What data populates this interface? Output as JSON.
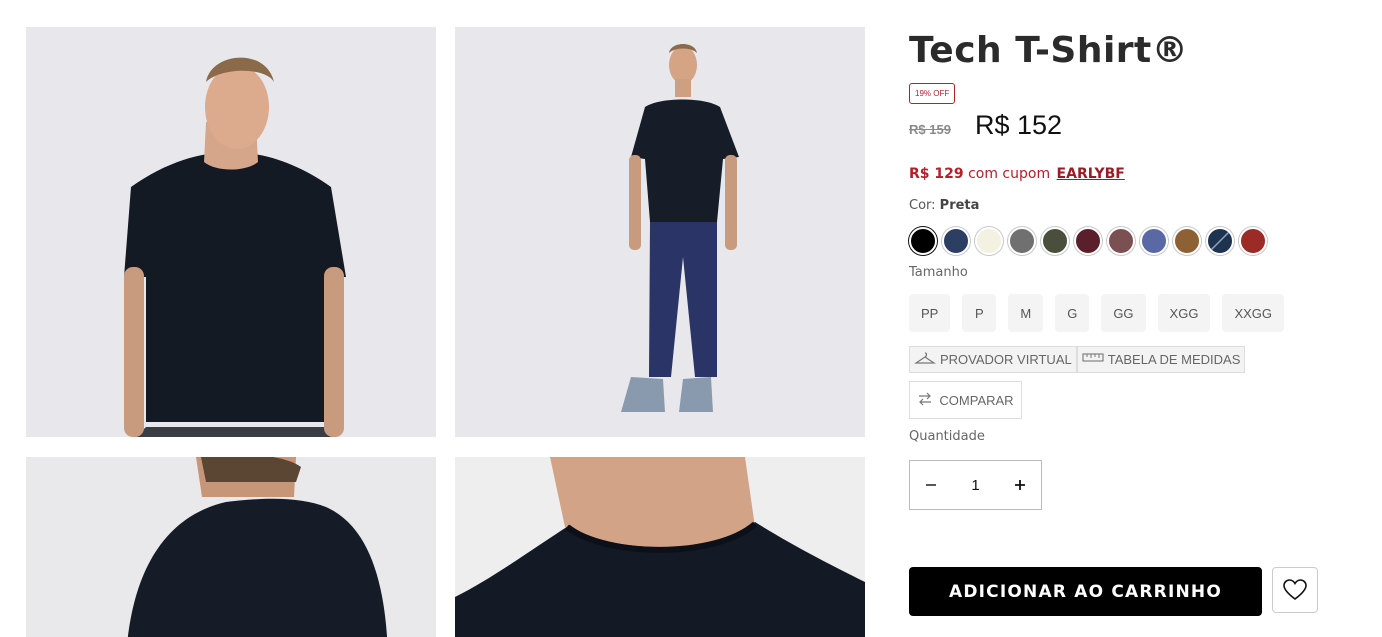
{
  "product": {
    "title": "Tech T-Shirt®",
    "discount_badge": "19% OFF",
    "old_price": "R$ 159",
    "price": "R$ 152",
    "coupon": {
      "value": "R$ 129",
      "text": "com cupom",
      "code": "EARLYBF"
    }
  },
  "color": {
    "label": "Cor:",
    "selected": "Preta",
    "swatches": [
      {
        "name": "black",
        "hex": "#000000"
      },
      {
        "name": "navy",
        "hex": "#2c3e62"
      },
      {
        "name": "off-white",
        "hex": "#f3f1e2"
      },
      {
        "name": "gray",
        "hex": "#707070"
      },
      {
        "name": "olive",
        "hex": "#4a4e3c"
      },
      {
        "name": "wine",
        "hex": "#5b1e2b"
      },
      {
        "name": "mauve",
        "hex": "#7a5052"
      },
      {
        "name": "periwinkle",
        "hex": "#5a69a6"
      },
      {
        "name": "caramel",
        "hex": "#8e6134"
      },
      {
        "name": "dark-navy-striped",
        "hex": "#1d3350"
      },
      {
        "name": "red",
        "hex": "#9c2a26"
      }
    ]
  },
  "size": {
    "label": "Tamanho",
    "options": [
      "PP",
      "P",
      "M",
      "G",
      "GG",
      "XGG",
      "XXGG"
    ]
  },
  "tools": {
    "virtual_fitting": "PROVADOR VIRTUAL",
    "size_chart": "TABELA DE MEDIDAS",
    "compare": "COMPARAR"
  },
  "quantity": {
    "label": "Quantidade",
    "value": "1"
  },
  "actions": {
    "add_to_cart": "ADICIONAR AO CARRINHO"
  }
}
